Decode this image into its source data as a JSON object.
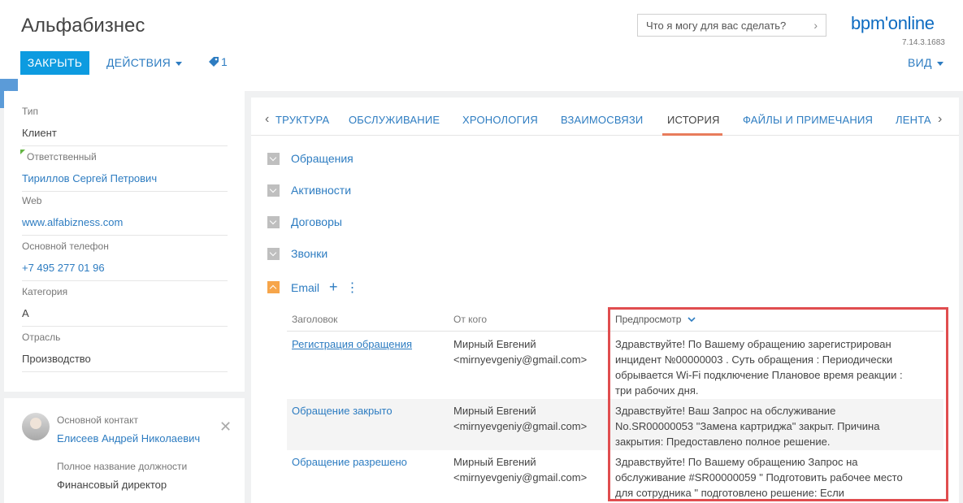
{
  "header": {
    "app_title": "Альфабизнес",
    "close_label": "ЗАКРЫТЬ",
    "actions_label": "ДЕЙСТВИЯ",
    "tag_count": "1",
    "search_placeholder": "Что я могу для вас сделать?",
    "logo": "bpm'online",
    "version": "7.14.3.1683",
    "view_label": "ВИД"
  },
  "left_panel": {
    "fields": [
      {
        "label": "Тип",
        "value": "Клиент"
      },
      {
        "label": "Ответственный",
        "value": "Тириллов Сергей Петрович"
      },
      {
        "label": "Web",
        "value": "www.alfabizness.com"
      },
      {
        "label": "Основной телефон",
        "value": "+7 495 277 01 96"
      },
      {
        "label": "Категория",
        "value": "A"
      },
      {
        "label": "Отрасль",
        "value": "Производство"
      }
    ]
  },
  "contact": {
    "main_contact_label": "Основной контакт",
    "main_contact_value": "Елисеев Андрей Николаевич",
    "job_title_label": "Полное название должности",
    "job_title_value": "Финансовый директор"
  },
  "tabs": [
    "ТРУКТУРА",
    "ОБСЛУЖИВАНИЕ",
    "ХРОНОЛОГИЯ",
    "ВЗАИМОСВЯЗИ",
    "ИСТОРИЯ",
    "ФАЙЛЫ И ПРИМЕЧАНИЯ",
    "ЛЕНТА"
  ],
  "groups": [
    {
      "title": "Обращения"
    },
    {
      "title": "Активности"
    },
    {
      "title": "Договоры"
    },
    {
      "title": "Звонки"
    },
    {
      "title": "Email"
    }
  ],
  "email_table": {
    "columns": [
      "Заголовок",
      "От кого",
      "Предпросмотр"
    ],
    "rows": [
      {
        "subject": "Регистрация обращения",
        "from_line1": "Мирный Евгений",
        "from_line2": "<mirnyevgeniy@gmail.com>",
        "preview": [
          "Здравствуйте! По Вашему обращению зарегистрирован",
          "инцидент №00000003 . Суть обращения : Периодически",
          "обрывается Wi-Fi подключение Плановое время реакции :",
          "три рабочих дня."
        ]
      },
      {
        "subject": "Обращение закрыто",
        "from_line1": "Мирный Евгений",
        "from_line2": "<mirnyevgeniy@gmail.com>",
        "preview": [
          "Здравствуйте! Ваш Запрос на обслуживание",
          "No.SR00000053 \"Замена картриджа\" закрыт. Причина",
          "закрытия: Предоставлено полное решение."
        ]
      },
      {
        "subject": "Обращение разрешено",
        "from_line1": "Мирный Евгений",
        "from_line2": "<mirnyevgeniy@gmail.com>",
        "preview": [
          "Здравствуйте! По Вашему обращению Запрос на",
          "обслуживание #SR00000059 \" Подготовить рабочее место",
          "для сотрудника \" подготовлено решение: Если"
        ]
      }
    ]
  }
}
